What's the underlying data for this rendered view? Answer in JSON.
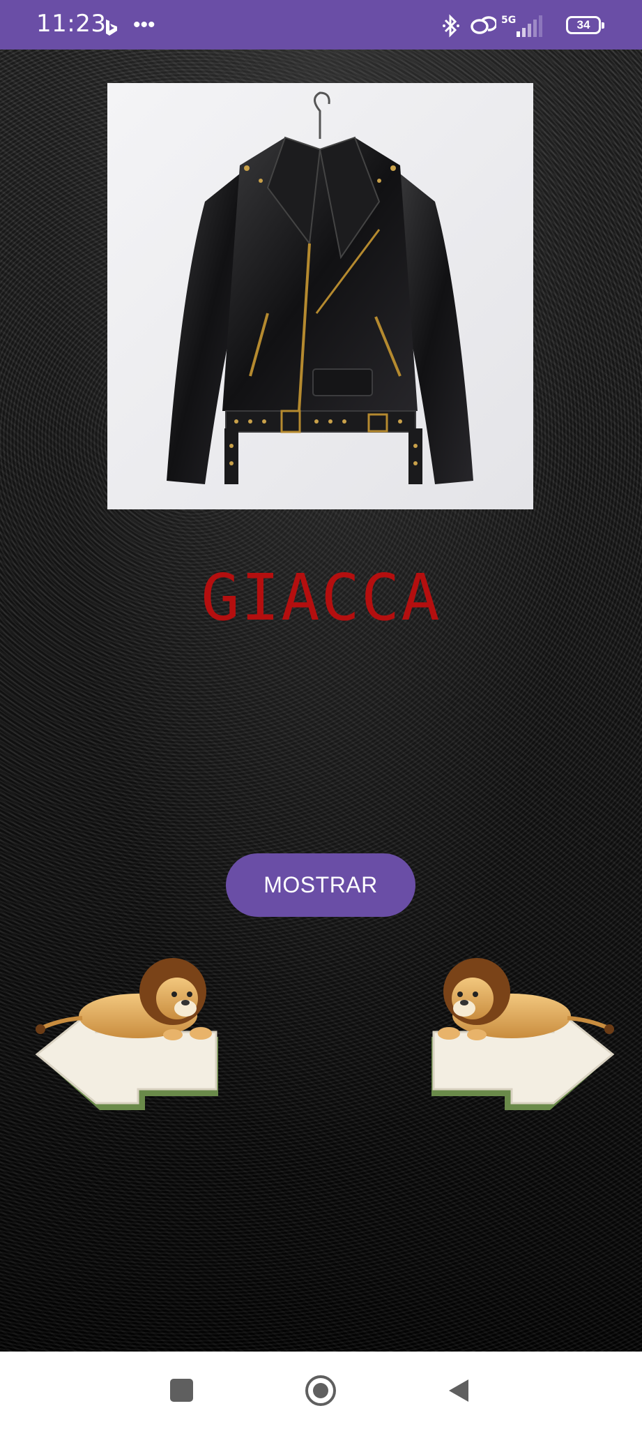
{
  "status_bar": {
    "time": "11:23",
    "battery": "34",
    "icons": [
      "bing-icon",
      "more-icon",
      "bluetooth-icon",
      "link-icon",
      "5g-signal-icon",
      "battery-icon"
    ],
    "background": "#6a4ea6"
  },
  "product": {
    "image_alt": "black leather biker jacket",
    "title": "GIACCA",
    "title_color": "#b40f0f"
  },
  "actions": {
    "show_label": "MOSTRAR",
    "button_color": "#6a4ea6",
    "prev_icon": "lion-left-arrow-icon",
    "next_icon": "lion-right-arrow-icon"
  },
  "nav_bar": {
    "icons": [
      "recents-icon",
      "home-icon",
      "back-icon"
    ]
  }
}
